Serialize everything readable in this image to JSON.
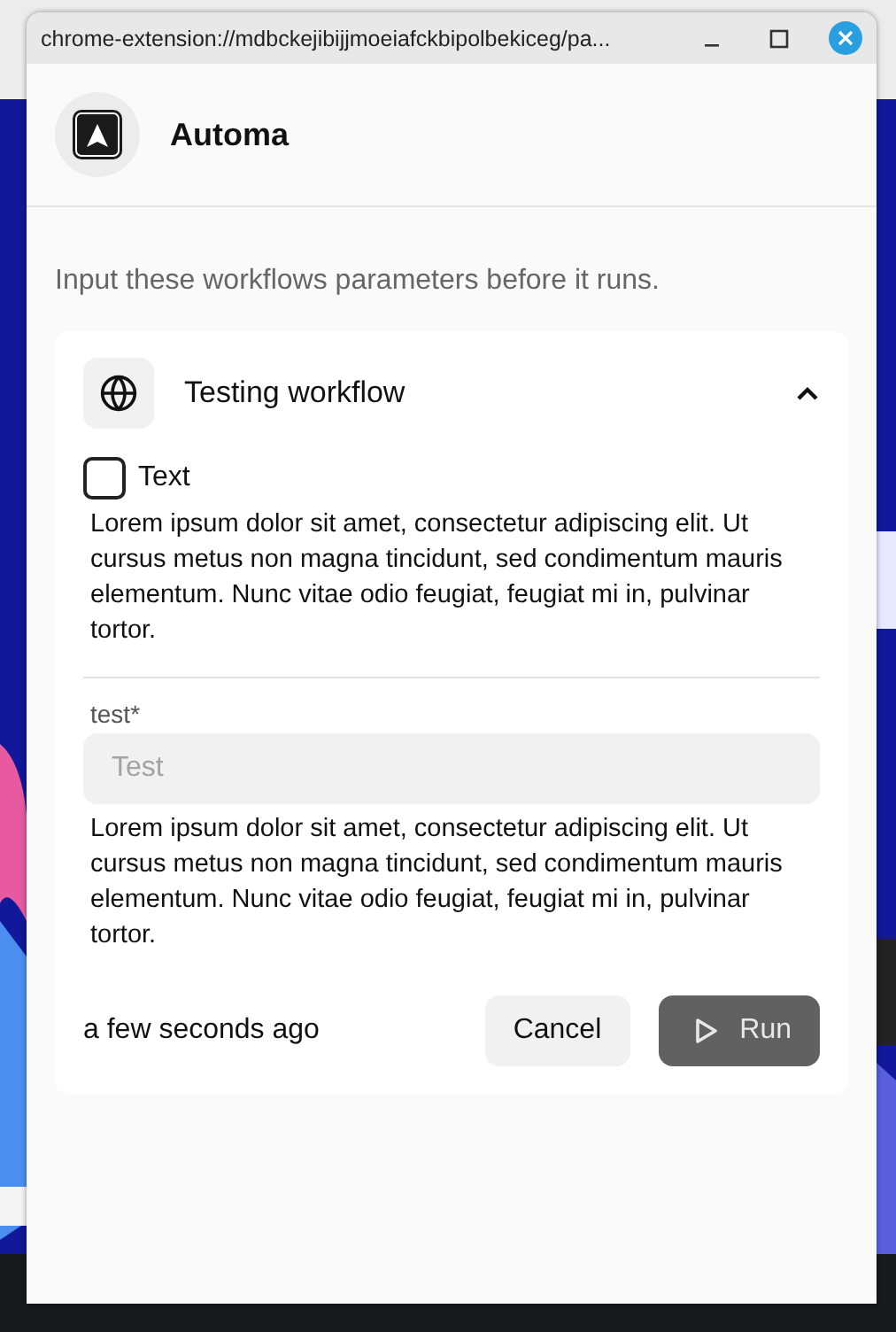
{
  "window": {
    "title": "chrome-extension://mdbckejibijjmoeiafckbipolbekiceg/pa..."
  },
  "app": {
    "name": "Automa"
  },
  "intro": "Input these workflows parameters before it runs.",
  "workflow": {
    "name": "Testing workflow",
    "expanded": true,
    "parameters": [
      {
        "kind": "checkbox",
        "label": "Text",
        "checked": false,
        "description": "Lorem ipsum dolor sit amet, consectetur adipiscing elit. Ut cursus metus non magna tincidunt, sed condimentum mauris elementum. Nunc vitae odio feugiat, feugiat mi in, pulvinar tortor."
      },
      {
        "kind": "input",
        "label": "test*",
        "placeholder": "Test",
        "description": "Lorem ipsum dolor sit amet, consectetur adipiscing elit. Ut cursus metus non magna tincidunt, sed condimentum mauris elementum. Nunc vitae odio feugiat, feugiat mi in, pulvinar tortor."
      }
    ],
    "time": "a few seconds ago",
    "buttons": [
      {
        "kind": "cancel",
        "label": "Cancel"
      },
      {
        "kind": "run",
        "label": "Run",
        "disabled": true
      }
    ]
  }
}
